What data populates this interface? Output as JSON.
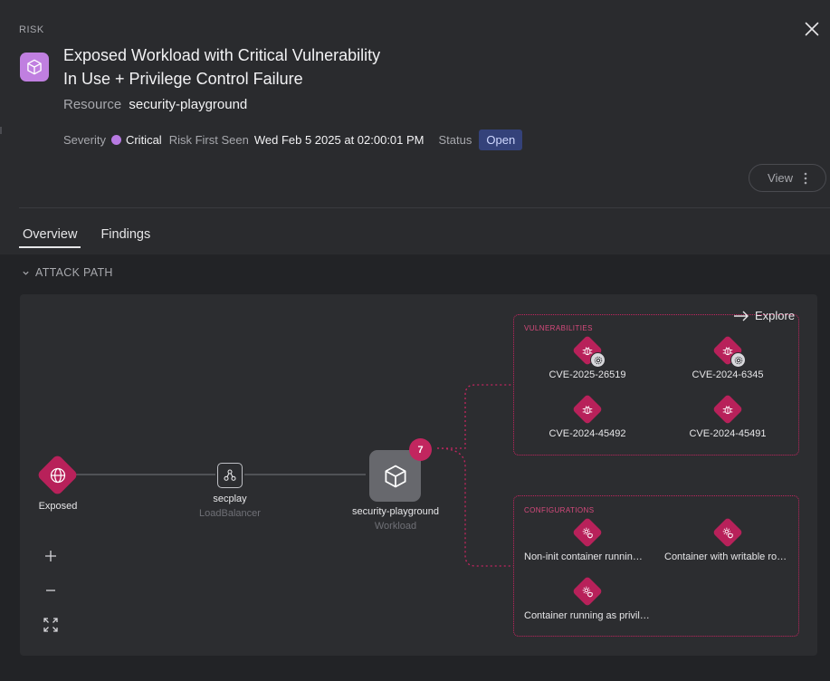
{
  "header": {
    "kind": "RISK",
    "title_line1": "Exposed Workload with Critical Vulnerability",
    "title_line2": "In Use + Privilege Control Failure",
    "resource_label": "Resource",
    "resource_value": "security-playground",
    "severity_label": "Severity",
    "severity_value": "Critical",
    "first_seen_label": "Risk First Seen",
    "first_seen_value": "Wed Feb 5 2025 at 02:00:01 PM",
    "status_label": "Status",
    "status_value": "Open",
    "view_label": "View"
  },
  "tabs": [
    {
      "label": "Overview",
      "active": true
    },
    {
      "label": "Findings",
      "active": false
    }
  ],
  "attack_path": {
    "section_title": "ATTACK PATH",
    "explore_label": "Explore",
    "nodes": {
      "exposed": {
        "label": "Exposed"
      },
      "loadbalancer": {
        "label": "secplay",
        "type": "LoadBalancer"
      },
      "workload": {
        "label": "security-playground",
        "type": "Workload",
        "finding_count": "7"
      }
    },
    "vulnerabilities": {
      "title": "VULNERABILITIES",
      "items": [
        {
          "label": "CVE-2025-26519",
          "in_use": true
        },
        {
          "label": "CVE-2024-6345",
          "in_use": true
        },
        {
          "label": "CVE-2024-45492",
          "in_use": false
        },
        {
          "label": "CVE-2024-45491",
          "in_use": false
        }
      ]
    },
    "configurations": {
      "title": "CONFIGURATIONS",
      "items": [
        {
          "label": "Non-init container runnin…"
        },
        {
          "label": "Container with writable ro…"
        },
        {
          "label": "Container running as privil…"
        }
      ]
    }
  },
  "colors": {
    "accent_critical": "#b8215a",
    "severity_dot": "#b77ae2",
    "status_bg": "#34427a",
    "header_icon_bg": "#c07fe0"
  }
}
